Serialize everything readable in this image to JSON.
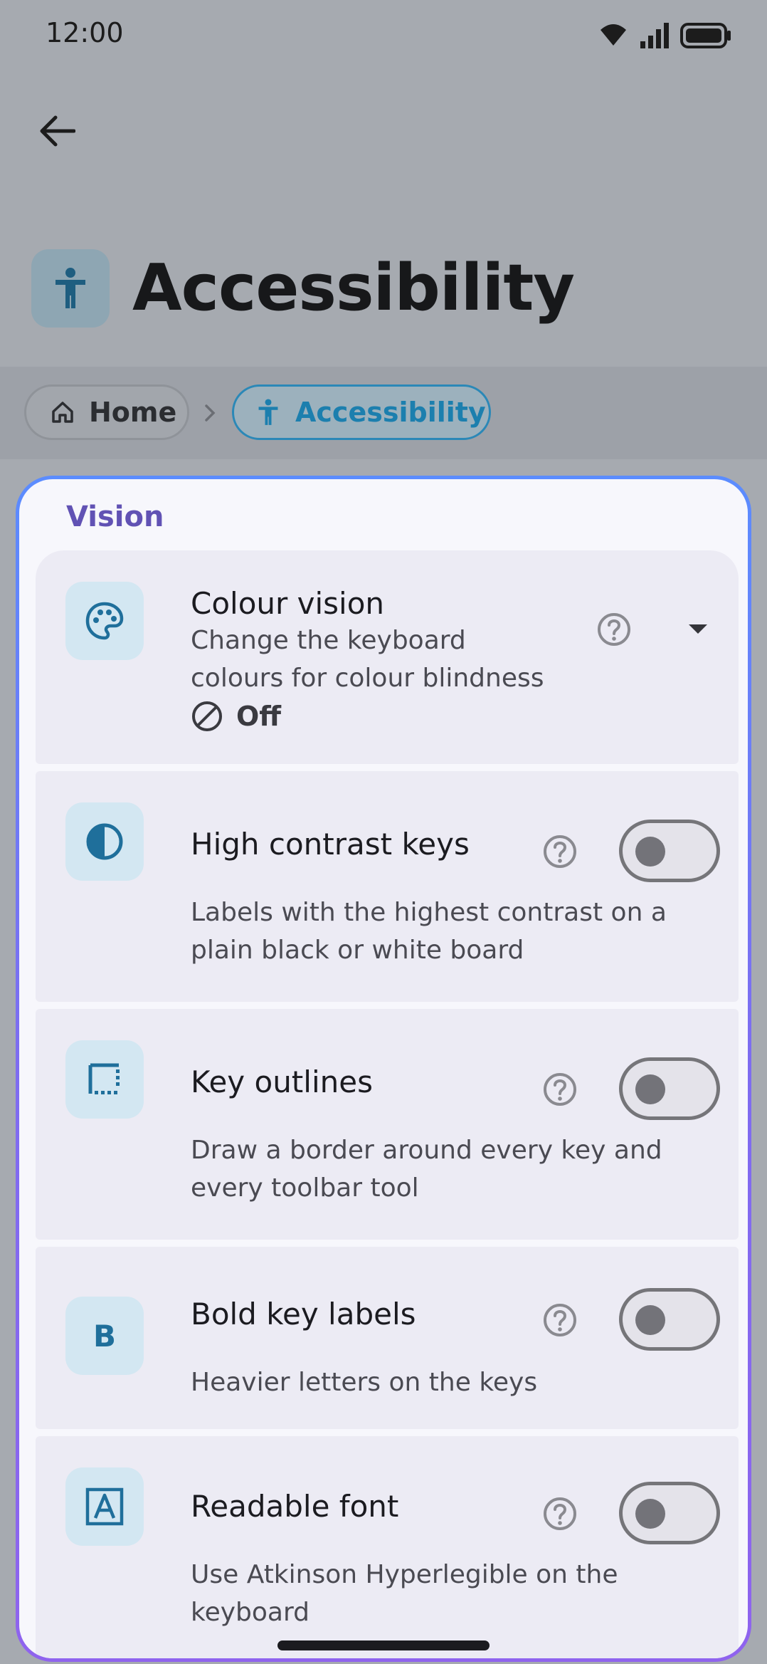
{
  "status_bar": {
    "time": "12:00"
  },
  "header": {
    "title": "Accessibility"
  },
  "breadcrumb": {
    "home": "Home",
    "current": "Accessibility"
  },
  "section": {
    "title": "Vision"
  },
  "settings": [
    {
      "title": "Colour vision",
      "description": "Change the keyboard colours for colour blindness",
      "value": "Off",
      "control": "dropdown"
    },
    {
      "title": "High contrast keys",
      "description": "Labels with the highest contrast on a plain black or white board",
      "control": "toggle",
      "on": false
    },
    {
      "title": "Key outlines",
      "description": "Draw a border around every key and every toolbar tool",
      "control": "toggle",
      "on": false
    },
    {
      "title": "Bold key labels",
      "description": "Heavier letters on the keys",
      "control": "toggle",
      "on": false
    },
    {
      "title": "Readable font",
      "description": "Use Atkinson Hyperlegible on the keyboard",
      "control": "toggle",
      "on": false
    }
  ],
  "colors": {
    "accent": "#6152b4",
    "link": "#1c7fae",
    "icon_bg": "#d3e7f2",
    "row_bg": "#ecebf4"
  },
  "icons": [
    "wifi-icon",
    "signal-icon",
    "battery-icon",
    "back-arrow-icon",
    "accessibility-icon",
    "home-icon",
    "chevron-right-icon",
    "palette-icon",
    "contrast-icon",
    "dotted-square-icon",
    "bold-icon",
    "font-icon",
    "help-icon",
    "dropdown-arrow-icon",
    "off-icon"
  ]
}
